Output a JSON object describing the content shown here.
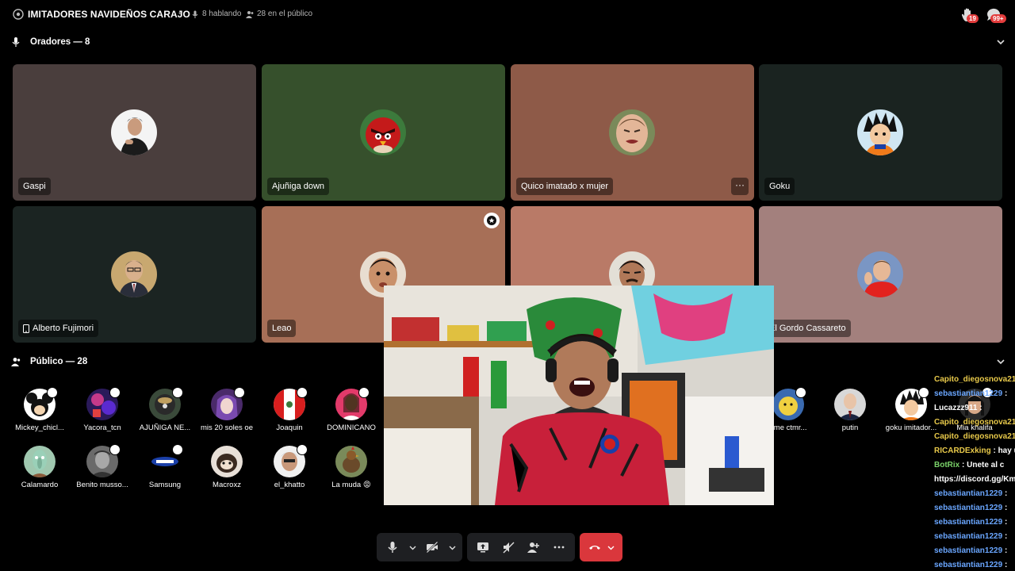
{
  "header": {
    "title": "IMITADORES NAVIDEÑOS CARAJO",
    "speaking": "8 hablando",
    "audience": "28 en el público",
    "hand_badge": "19",
    "chat_badge": "99+"
  },
  "speakers_section": {
    "label": "Oradores — 8"
  },
  "audience_section": {
    "label": "Público — 28"
  },
  "speakers": [
    {
      "name": "Gaspi",
      "bg": "#4a3e3d"
    },
    {
      "name": "Ajuñiga down",
      "bg": "#36502c"
    },
    {
      "name": "Quico imatado x mujer",
      "bg": "#8e5a48",
      "more": "···"
    },
    {
      "name": "Goku",
      "bg": "#1a2320"
    },
    {
      "name": "Alberto Fujimori",
      "bg": "#1b2422",
      "mobile": true
    },
    {
      "name": "Leao",
      "bg": "#a76f57"
    },
    {
      "name": "",
      "bg": "#b97a67"
    },
    {
      "name": "El Gordo Cassareto",
      "bg": "#a3807d"
    }
  ],
  "audience": [
    {
      "name": "Mickey_chicl...",
      "hand": true
    },
    {
      "name": "Yacora_tcn",
      "hand": true
    },
    {
      "name": "AJUÑIGA NE...",
      "hand": true
    },
    {
      "name": "mis 20 soles oe",
      "hand": true
    },
    {
      "name": "Joaquin",
      "hand": true
    },
    {
      "name": "DOMINICANO",
      "hand": true
    },
    {
      "name": "eme ctmr...",
      "hand": true
    },
    {
      "name": "putin",
      "hand": false
    },
    {
      "name": "goku imitador...",
      "hand": true
    },
    {
      "name": "Mia khalifa",
      "hand": true
    },
    {
      "name": "Calamardo",
      "hand": false
    },
    {
      "name": "Benito musso...",
      "hand": true
    },
    {
      "name": "Samsung",
      "hand": true
    },
    {
      "name": "Macroxz",
      "hand": false
    },
    {
      "name": "el_khatto",
      "hand": true
    },
    {
      "name": "La muda 😡",
      "hand": false
    }
  ],
  "chat": [
    {
      "user": "Capito_diegosnova21",
      "msg": "",
      "color": "#e8c94a"
    },
    {
      "user": "sebastiantian1229",
      "msg": " :",
      "color": "#6aa6ff"
    },
    {
      "user": "Lucazzz911",
      "msg": " :",
      "color": "#ffffff"
    },
    {
      "user": "Capito_diegosnova21",
      "msg": "",
      "color": "#e8c94a"
    },
    {
      "user": "Capito_diegosnova21",
      "msg": "",
      "color": "#e8c94a"
    },
    {
      "user": "RICARDExking",
      "msg": " : hay un",
      "color": "#e8c94a"
    },
    {
      "user": "BotRix",
      "msg": " : Unete al c",
      "color": "#7bd36a"
    },
    {
      "user": "https://discord.gg/Kmb",
      "msg": "",
      "color": "#ffffff"
    },
    {
      "user": "sebastiantian1229",
      "msg": " :",
      "color": "#6aa6ff"
    },
    {
      "user": "sebastiantian1229",
      "msg": " :",
      "color": "#6aa6ff"
    },
    {
      "user": "sebastiantian1229",
      "msg": " :",
      "color": "#6aa6ff"
    },
    {
      "user": "sebastiantian1229",
      "msg": " :",
      "color": "#6aa6ff"
    },
    {
      "user": "sebastiantian1229",
      "msg": " :",
      "color": "#6aa6ff"
    },
    {
      "user": "sebastiantian1229",
      "msg": " :",
      "color": "#6aa6ff"
    }
  ],
  "colors": {
    "hangup": "#da373c",
    "control_bg": "#1e1f22",
    "mention_badge": "#e23c3c"
  }
}
